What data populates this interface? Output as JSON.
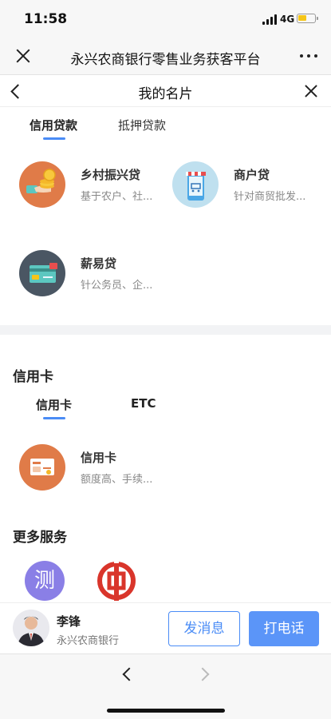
{
  "status_bar": {
    "time": "11:58",
    "network": "4G",
    "battery_level": 0.55
  },
  "wechat_header": {
    "title": "永兴农商银行零售业务获客平台"
  },
  "page_header": {
    "title": "我的名片"
  },
  "loan_tabs": [
    {
      "label": "信用贷款",
      "active": true
    },
    {
      "label": "抵押贷款",
      "active": false
    }
  ],
  "loan_products": [
    {
      "name": "乡村振兴贷",
      "desc": "基于农户、社...",
      "icon": "rural-revitalization-icon"
    },
    {
      "name": "商户贷",
      "desc": "针对商贸批发...",
      "icon": "merchant-shop-icon"
    },
    {
      "name": "薪易贷",
      "desc": "针公务员、企...",
      "icon": "salary-card-icon"
    }
  ],
  "credit_card_section": {
    "title": "信用卡",
    "tabs": [
      {
        "label": "信用卡",
        "active": true
      },
      {
        "label": "ETC",
        "active": false
      }
    ],
    "products": [
      {
        "name": "信用卡",
        "desc": "额度高、手续...",
        "icon": "bank-card-icon"
      }
    ]
  },
  "more_services": {
    "title": "更多服务",
    "items": [
      {
        "icon": "ce-char-icon",
        "glyph": "测"
      },
      {
        "icon": "bank-logo-icon"
      }
    ]
  },
  "contact": {
    "name": "李锋",
    "org": "永兴农商银行",
    "message_button": "发消息",
    "call_button": "打电话"
  },
  "colors": {
    "accent": "#4a8cf6",
    "call_button": "#5b95f8",
    "orange_icon": "#e07b48",
    "light_blue_icon": "#bfe0ef",
    "slate_icon": "#4a5663",
    "purple_icon": "#8a7fe6",
    "red_logo": "#d9352b"
  }
}
